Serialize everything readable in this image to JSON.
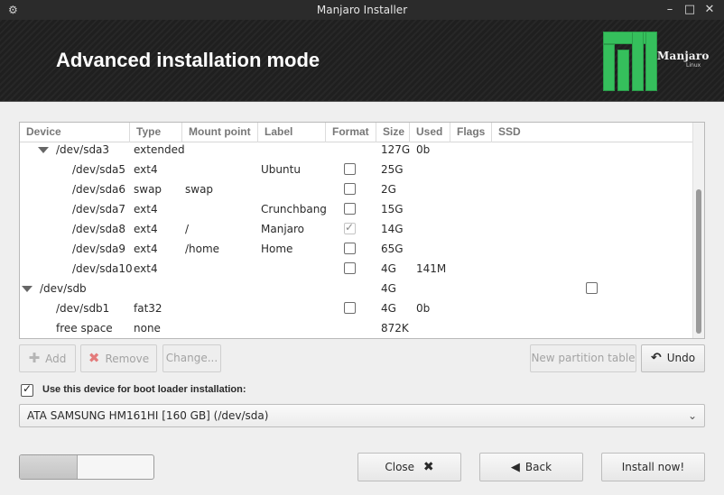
{
  "window": {
    "title": "Manjaro Installer"
  },
  "header": {
    "title": "Advanced installation mode",
    "logo_text": "Manjaro",
    "logo_sub": "Linux"
  },
  "columns": [
    "Device",
    "Type",
    "Mount point",
    "Label",
    "Format",
    "Size",
    "Used",
    "Flags",
    "SSD"
  ],
  "rows": [
    {
      "device": "/dev/sda3",
      "type": "extended",
      "mount": "",
      "label": "",
      "size": "127G",
      "used": "0b"
    },
    {
      "device": "/dev/sda5",
      "type": "ext4",
      "mount": "",
      "label": "Ubuntu",
      "size": "25G",
      "used": ""
    },
    {
      "device": "/dev/sda6",
      "type": "swap",
      "mount": "swap",
      "label": "",
      "size": "2G",
      "used": ""
    },
    {
      "device": "/dev/sda7",
      "type": "ext4",
      "mount": "",
      "label": "Crunchbang",
      "size": "15G",
      "used": ""
    },
    {
      "device": "/dev/sda8",
      "type": "ext4",
      "mount": "/",
      "label": "Manjaro",
      "size": "14G",
      "used": ""
    },
    {
      "device": "/dev/sda9",
      "type": "ext4",
      "mount": "/home",
      "label": "Home",
      "size": "65G",
      "used": ""
    },
    {
      "device": "/dev/sda10",
      "type": "ext4",
      "mount": "",
      "label": "",
      "size": "4G",
      "used": "141M"
    },
    {
      "device": "/dev/sdb",
      "type": "",
      "mount": "",
      "label": "",
      "size": "4G",
      "used": ""
    },
    {
      "device": "/dev/sdb1",
      "type": "fat32",
      "mount": "",
      "label": "",
      "size": "4G",
      "used": "0b"
    },
    {
      "device": "free space",
      "type": "none",
      "mount": "",
      "label": "",
      "size": "872K",
      "used": ""
    }
  ],
  "format_checks": [
    false,
    false,
    false,
    true,
    false,
    false,
    false,
    false
  ],
  "ssd_checked": false,
  "buttons": {
    "add": "Add",
    "remove": "Remove",
    "change": "Change...",
    "new_table": "New partition table",
    "undo": "Undo",
    "close": "Close",
    "back": "Back",
    "install": "Install now!"
  },
  "boot_loader": {
    "checkbox_label": "Use this device for boot loader installation:",
    "checked": true,
    "device": "ATA SAMSUNG HM161HI [160 GB] (/dev/sda)"
  },
  "progress": {
    "fraction": 0.43
  }
}
